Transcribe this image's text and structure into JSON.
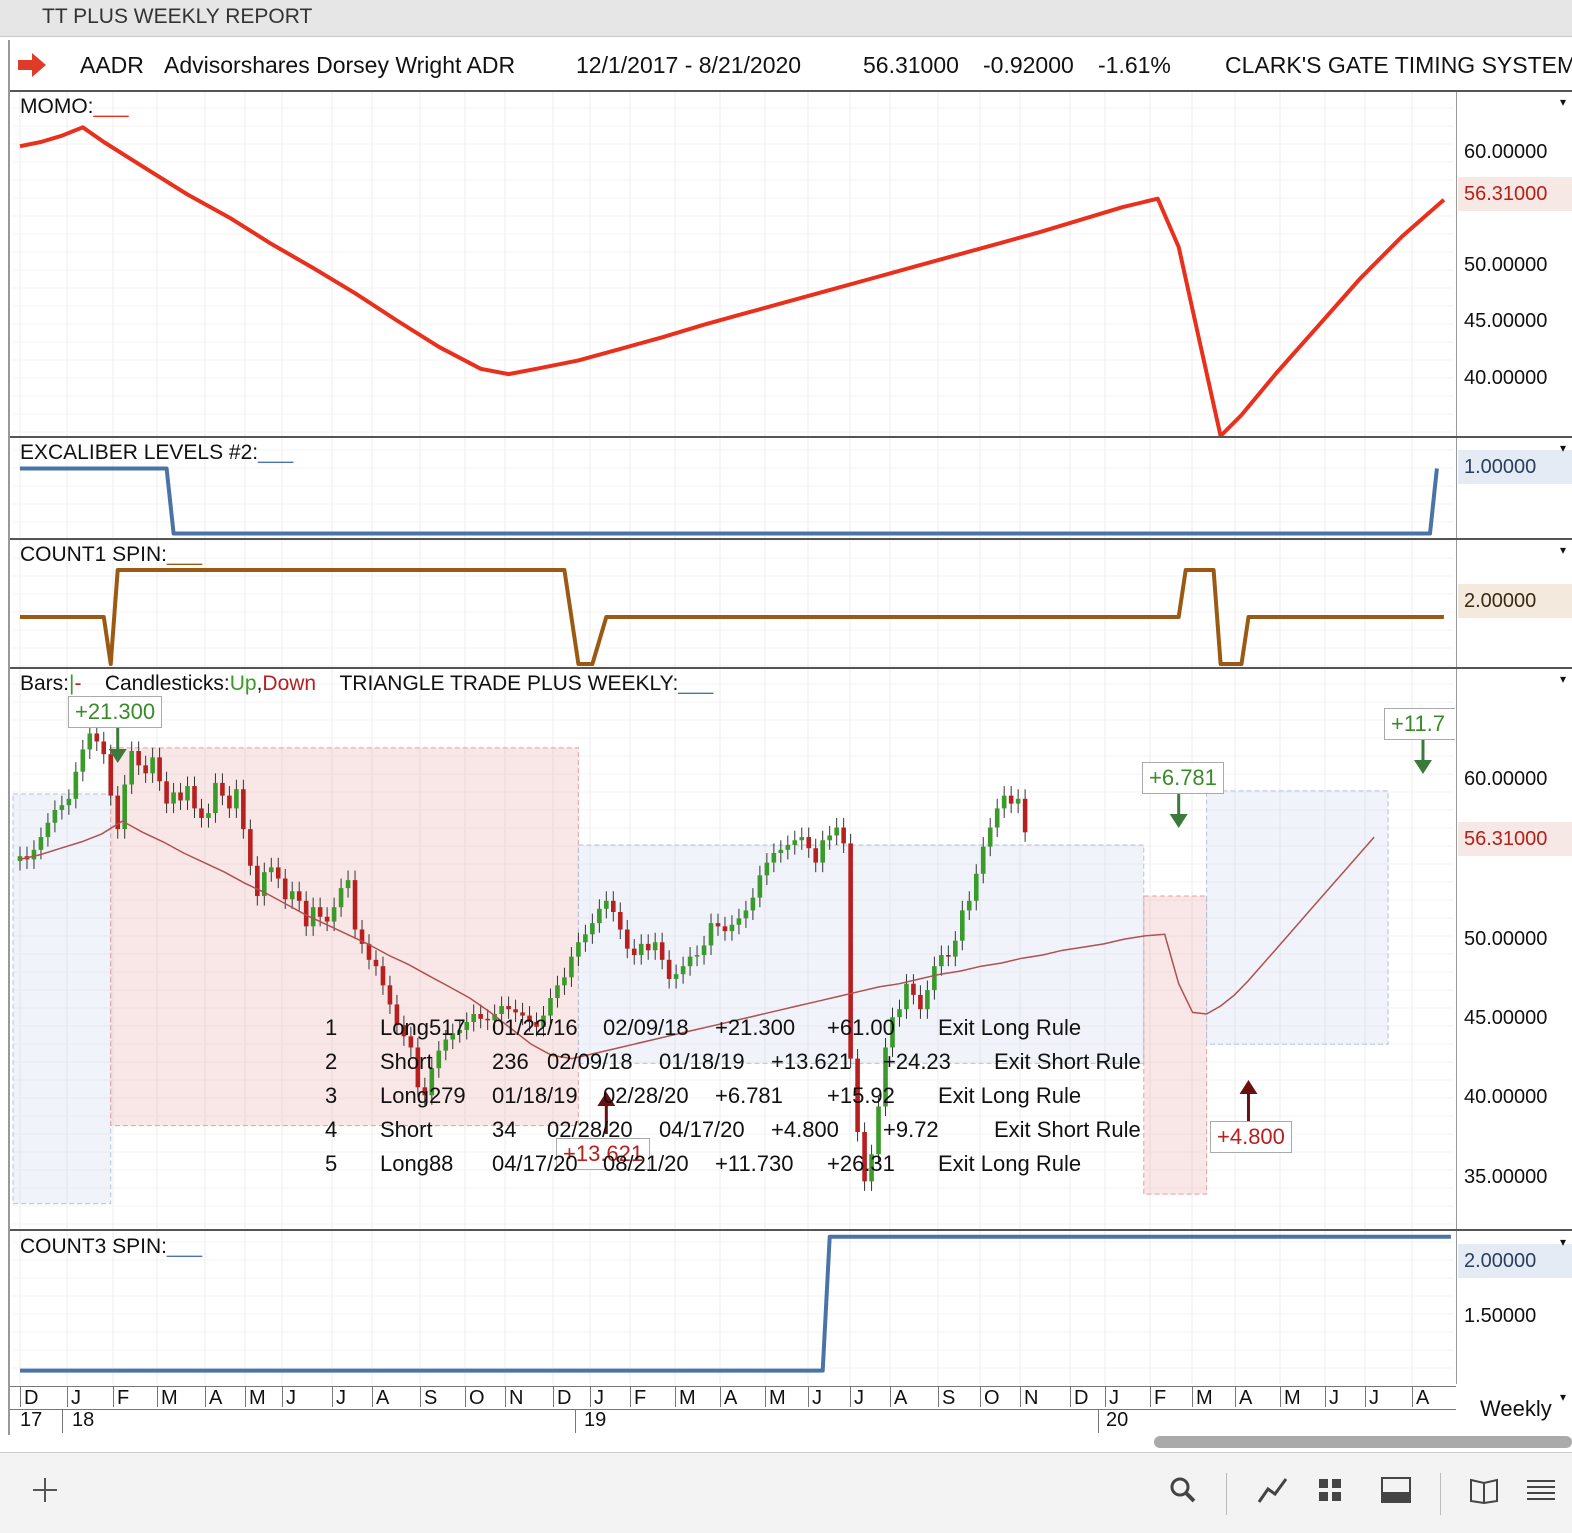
{
  "window_title": "TT PLUS WEEKLY REPORT",
  "header": {
    "symbol": "AADR",
    "name": "Advisorshares Dorsey Wright ADR",
    "date_range": "12/1/2017 - 8/21/2020",
    "price": "56.31000",
    "change": "-0.92000",
    "change_pct": "-1.61%",
    "system": "CLARK'S GATE TIMING SYSTEM"
  },
  "colors": {
    "up": "#3a9a2a",
    "down": "#b82020",
    "momo": "#e8301c",
    "excalibur": "#4a73a8",
    "count1": "#9a5a14",
    "count3": "#4a73a8"
  },
  "panels": {
    "momo": {
      "label": "MOMO:",
      "ticks": [
        "60.00000",
        "50.00000",
        "45.00000",
        "40.00000"
      ],
      "last": "56.31000",
      "series": [
        [
          0,
          60.6
        ],
        [
          3,
          61.0
        ],
        [
          6,
          61.6
        ],
        [
          9,
          62.4
        ],
        [
          12,
          61.0
        ],
        [
          18,
          58.5
        ],
        [
          24,
          56.0
        ],
        [
          30,
          53.8
        ],
        [
          36,
          51.3
        ],
        [
          42,
          49.0
        ],
        [
          48,
          46.6
        ],
        [
          54,
          44.0
        ],
        [
          60,
          41.5
        ],
        [
          66,
          39.4
        ],
        [
          70,
          38.9
        ],
        [
          74,
          39.4
        ],
        [
          80,
          40.2
        ],
        [
          86,
          41.3
        ],
        [
          92,
          42.4
        ],
        [
          98,
          43.6
        ],
        [
          104,
          44.7
        ],
        [
          110,
          45.8
        ],
        [
          116,
          46.9
        ],
        [
          122,
          48.0
        ],
        [
          128,
          49.1
        ],
        [
          134,
          50.2
        ],
        [
          140,
          51.3
        ],
        [
          146,
          52.4
        ],
        [
          152,
          53.6
        ],
        [
          158,
          54.8
        ],
        [
          163,
          55.6
        ],
        [
          166,
          51.0
        ],
        [
          169,
          42.0
        ],
        [
          172,
          33.0
        ],
        [
          175,
          35.0
        ],
        [
          180,
          39.0
        ],
        [
          186,
          43.5
        ],
        [
          192,
          48.0
        ],
        [
          198,
          52.0
        ],
        [
          204,
          55.5
        ]
      ],
      "ylim": [
        33.0,
        65.0
      ]
    },
    "excalibur": {
      "label": "EXCALIBER LEVELS #2:",
      "last": "1.00000",
      "series": [
        [
          0,
          1
        ],
        [
          21,
          1
        ],
        [
          22,
          0
        ],
        [
          202,
          0
        ],
        [
          203,
          1
        ]
      ],
      "ylim": [
        -0.1,
        1.1
      ]
    },
    "count1": {
      "label": "COUNT1 SPIN:",
      "last": "2.00000",
      "series": [
        [
          0,
          2
        ],
        [
          12,
          2
        ],
        [
          13,
          1
        ],
        [
          14,
          3
        ],
        [
          78,
          3
        ],
        [
          80,
          1
        ],
        [
          82,
          1
        ],
        [
          84,
          2
        ],
        [
          166,
          2
        ],
        [
          167,
          3
        ],
        [
          171,
          3
        ],
        [
          172,
          1
        ],
        [
          175,
          1
        ],
        [
          176,
          2
        ],
        [
          204,
          2
        ]
      ],
      "ylim": [
        1,
        3
      ]
    },
    "main": {
      "label_bars": "Bars:",
      "label_candles": "Candlesticks:",
      "label_up": "Up",
      "label_comma": ",",
      "label_down": "Down",
      "label_tt": "TRIANGLE TRADE PLUS WEEKLY:",
      "ticks": [
        "60.00000",
        "50.00000",
        "45.00000",
        "40.00000",
        "35.00000"
      ],
      "last": "56.31000",
      "ylim": [
        31.6,
        64.6
      ],
      "annotations": [
        "+21.300",
        "+13.621",
        "+6.781",
        "+4.800",
        "+11.7"
      ],
      "trades": [
        [
          "1",
          "Long517",
          "01/22/16",
          "02/09/18",
          "+21.300",
          "+61.00",
          "Exit Long Rule"
        ],
        [
          "2",
          "Short",
          "236",
          "02/09/18",
          "01/18/19",
          "+13.621",
          "+24.23",
          "Exit Short Rule"
        ],
        [
          "3",
          "Long279",
          "01/18/19",
          "02/28/20",
          "+6.781",
          "+15.92",
          "Exit Long Rule"
        ],
        [
          "4",
          "Short",
          "34",
          "02/28/20",
          "04/17/20",
          "+4.800",
          "+9.72",
          "Exit Short Rule"
        ],
        [
          "5",
          "Long88",
          "04/17/20",
          "08/21/20",
          "+11.730",
          "+26.31",
          "Exit Long Rule"
        ]
      ],
      "closes": [
        54.8,
        54.6,
        55.2,
        56.0,
        56.9,
        57.7,
        58.0,
        58.4,
        60.1,
        61.5,
        62.5,
        62.0,
        61.2,
        58.6,
        56.5,
        59.3,
        61.4,
        60.5,
        60.0,
        61.0,
        59.5,
        58.1,
        58.8,
        58.3,
        59.2,
        57.8,
        57.2,
        57.5,
        59.4,
        58.6,
        57.8,
        59.0,
        56.5,
        54.2,
        52.3,
        53.8,
        54.1,
        53.4,
        52.1,
        52.6,
        52.0,
        50.4,
        51.6,
        51.0,
        50.7,
        51.6,
        52.8,
        53.3,
        50.2,
        49.3,
        48.3,
        47.9,
        46.7,
        45.5,
        44.2,
        43.5,
        42.8,
        40.3,
        39.8,
        41.5,
        42.6,
        43.3,
        43.7,
        43.9,
        44.4,
        44.9,
        44.6,
        44.5,
        44.9,
        45.4,
        45.2,
        45.0,
        44.8,
        44.4,
        44.1,
        44.8,
        45.9,
        46.7,
        47.2,
        48.5,
        49.4,
        49.9,
        50.6,
        51.5,
        52.0,
        51.3,
        50.2,
        49.0,
        48.6,
        49.3,
        48.9,
        49.4,
        48.3,
        47.1,
        47.4,
        47.9,
        48.5,
        48.6,
        49.2,
        50.6,
        50.4,
        50.1,
        50.5,
        50.9,
        51.4,
        52.2,
        53.6,
        54.4,
        55.0,
        55.2,
        55.5,
        55.8,
        56.0,
        55.3,
        54.4,
        55.8,
        56.1,
        56.6,
        55.6,
        42.1,
        37.5,
        34.4,
        36.1,
        39.1,
        42.8,
        44.7,
        45.2,
        46.8,
        46.1,
        45.2,
        46.4,
        47.9,
        48.6,
        48.5,
        49.5,
        51.4,
        52.0,
        53.7,
        55.4,
        56.6,
        57.8,
        58.6,
        58.1,
        58.4,
        56.3
      ],
      "ma": [
        54.6,
        54.9,
        55.3,
        55.7,
        56.2,
        57.0,
        56.3,
        55.7,
        55.0,
        54.4,
        53.8,
        53.1,
        52.5,
        51.8,
        51.1,
        50.5,
        49.9,
        49.3,
        48.6,
        48.0,
        47.3,
        46.6,
        45.9,
        45.0,
        44.0,
        43.0,
        42.3,
        42.1,
        42.4,
        42.7,
        43.0,
        43.3,
        43.6,
        43.9,
        44.2,
        44.5,
        44.8,
        45.1,
        45.4,
        45.7,
        46.0,
        46.3,
        46.6,
        46.8,
        47.1,
        47.4,
        47.6,
        47.9,
        48.1,
        48.4,
        48.6,
        48.9,
        49.1,
        49.3,
        49.6,
        49.8,
        49.9,
        46.8,
        45.0,
        44.9,
        45.4,
        46.1,
        47.0,
        48.0,
        49.0,
        50.0,
        51.0,
        52.0,
        53.0,
        54.0,
        55.0,
        56.0
      ],
      "trade_boxes": [
        {
          "x0": -1,
          "x1": 13,
          "ylo": 33.0,
          "yhi": 58.7,
          "side": "long"
        },
        {
          "x0": 13,
          "x1": 80,
          "ylo": 37.9,
          "yhi": 61.6,
          "side": "short"
        },
        {
          "x0": 80,
          "x1": 161,
          "ylo": 41.8,
          "yhi": 55.5,
          "side": "long"
        },
        {
          "x0": 161,
          "x1": 170,
          "ylo": 33.6,
          "yhi": 52.3,
          "side": "short"
        },
        {
          "x0": 170,
          "x1": 196,
          "ylo": 43.0,
          "yhi": 58.9,
          "side": "long"
        }
      ]
    },
    "count3": {
      "label": "COUNT3 SPIN:",
      "ticks": [
        "1.50000"
      ],
      "last": "2.00000",
      "series": [
        [
          0,
          1
        ],
        [
          115,
          1
        ],
        [
          116,
          2
        ],
        [
          205,
          2
        ]
      ],
      "ylim": [
        0.9,
        2.05
      ]
    }
  },
  "xaxis": {
    "months": [
      "D",
      "J",
      "F",
      "M",
      "A",
      "M",
      "J",
      "J",
      "A",
      "S",
      "O",
      "N",
      "D",
      "J",
      "F",
      "M",
      "A",
      "M",
      "J",
      "J",
      "A",
      "S",
      "O",
      "N",
      "D",
      "J",
      "F",
      "M",
      "A",
      "M",
      "J",
      "J",
      "A"
    ],
    "years": [
      "17",
      "18",
      "19",
      "20"
    ],
    "interval": "Weekly"
  }
}
